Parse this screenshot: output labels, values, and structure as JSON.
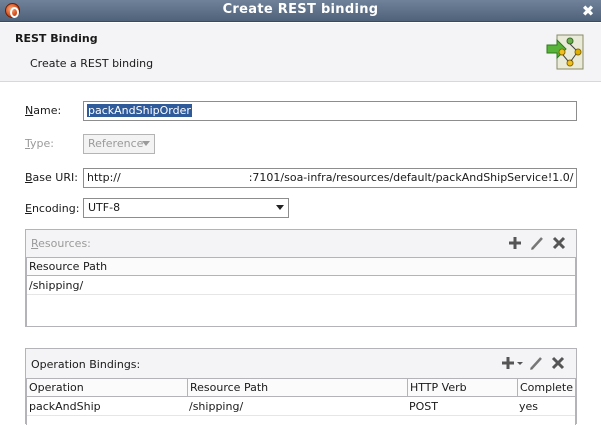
{
  "window": {
    "title": "Create REST binding",
    "close_glyph": "✖"
  },
  "header": {
    "title": "REST Binding",
    "subtitle": "Create a REST binding",
    "icon": "rest-binding-wizard-icon"
  },
  "form": {
    "name": {
      "mnemonic": "N",
      "label_rest": "ame:",
      "value": "packAndShipOrder"
    },
    "type": {
      "mnemonic": "T",
      "label_rest": "ype:",
      "value": "Reference"
    },
    "base_uri": {
      "mnemonic": "B",
      "label_rest": "ase URI:",
      "value_prefix": "http://",
      "value_suffix": ":7101/soa-infra/resources/default/packAndShipService!1.0/"
    },
    "encoding": {
      "mnemonic": "E",
      "label_rest": "ncoding:",
      "value": "UTF-8"
    }
  },
  "resources": {
    "title_mnemonic": "R",
    "title_rest": "esources:",
    "columns": [
      "Resource Path"
    ],
    "rows": [
      [
        "/shipping/"
      ]
    ]
  },
  "operations": {
    "title": "Operation Bindings:",
    "columns": [
      "Operation",
      "Resource Path",
      "HTTP Verb",
      "Complete"
    ],
    "rows": [
      [
        "packAndShip",
        "/shipping/",
        "POST",
        "yes"
      ]
    ]
  },
  "colors": {
    "titlebar": "#5a6d86",
    "selection": "#2f5b9a",
    "panel_bg": "#f4f4f6"
  }
}
